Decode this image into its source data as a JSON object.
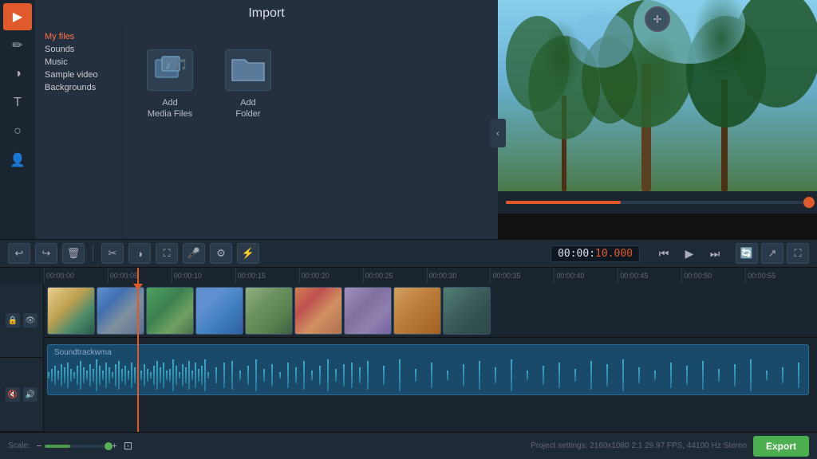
{
  "app": {
    "title": "Import"
  },
  "sidebar": {
    "icons": [
      {
        "name": "video-icon",
        "symbol": "▶",
        "active": true
      },
      {
        "name": "edit-icon",
        "symbol": "✏"
      },
      {
        "name": "color-icon",
        "symbol": "◑"
      },
      {
        "name": "text-icon",
        "symbol": "T"
      },
      {
        "name": "circle-icon",
        "symbol": "○"
      },
      {
        "name": "person-icon",
        "symbol": "👤"
      }
    ]
  },
  "file_tree": {
    "items": [
      {
        "label": "My files",
        "active": true
      },
      {
        "label": "Sounds"
      },
      {
        "label": "Music"
      },
      {
        "label": "Sample video"
      },
      {
        "label": "Backgrounds"
      }
    ]
  },
  "import": {
    "title": "Import",
    "buttons": [
      {
        "label": "Add\nMedia Files",
        "icon": "🎬"
      },
      {
        "label": "Add\nFolder",
        "icon": "📁"
      }
    ]
  },
  "toolbar": {
    "undo_label": "↩",
    "redo_label": "↪",
    "delete_label": "🗑",
    "cut_label": "✂",
    "contrast_label": "◑",
    "image_label": "⛶",
    "mic_label": "🎤",
    "gear_label": "⚙",
    "sliders_label": "⚡"
  },
  "time": {
    "display": "00:00:10.000",
    "seconds_highlight": "10.000"
  },
  "timeline": {
    "ruler_marks": [
      "00:00:00",
      "00:00:05",
      "00:00:10",
      "00:00:15",
      "00:00:20",
      "00:00:25",
      "00:00:30",
      "00:00:35",
      "00:00:40",
      "00:00:45",
      "00:00:50",
      "00:00:55"
    ],
    "audio_label": "Soundtrackwma"
  },
  "bottom": {
    "scale_label": "Scale:",
    "project_settings": "Project settings: 2160x1080 2:1 29.97 FPS, 44100 Hz Stereo",
    "export_label": "Export"
  },
  "transport": {
    "skip_back": "⏮",
    "play": "▶",
    "skip_forward": "⏭"
  }
}
